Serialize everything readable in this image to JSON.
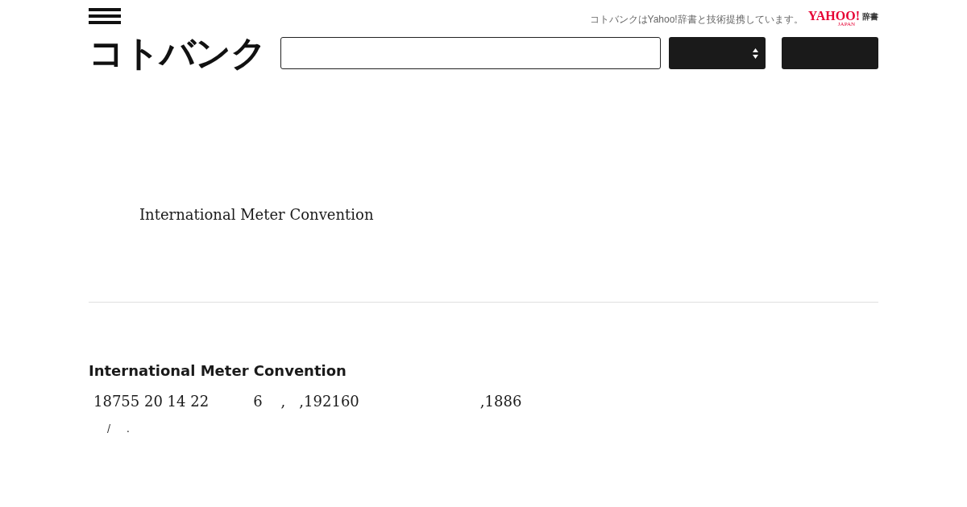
{
  "header": {
    "logo": "コトバンク",
    "notice": "コトバンクはYahoo!辞書と技術提携しています。",
    "partner_logo": {
      "main": "YAHOO!",
      "sub": "JAPAN",
      "suffix": "辞書"
    }
  },
  "title": "International Meter Convention",
  "entry": {
    "heading": "International Meter Convention",
    "line_1": [
      "18755 20 14 22",
      "6    ,   ,192160",
      ",1886"
    ],
    "line_2": [
      "/",
      "."
    ]
  }
}
